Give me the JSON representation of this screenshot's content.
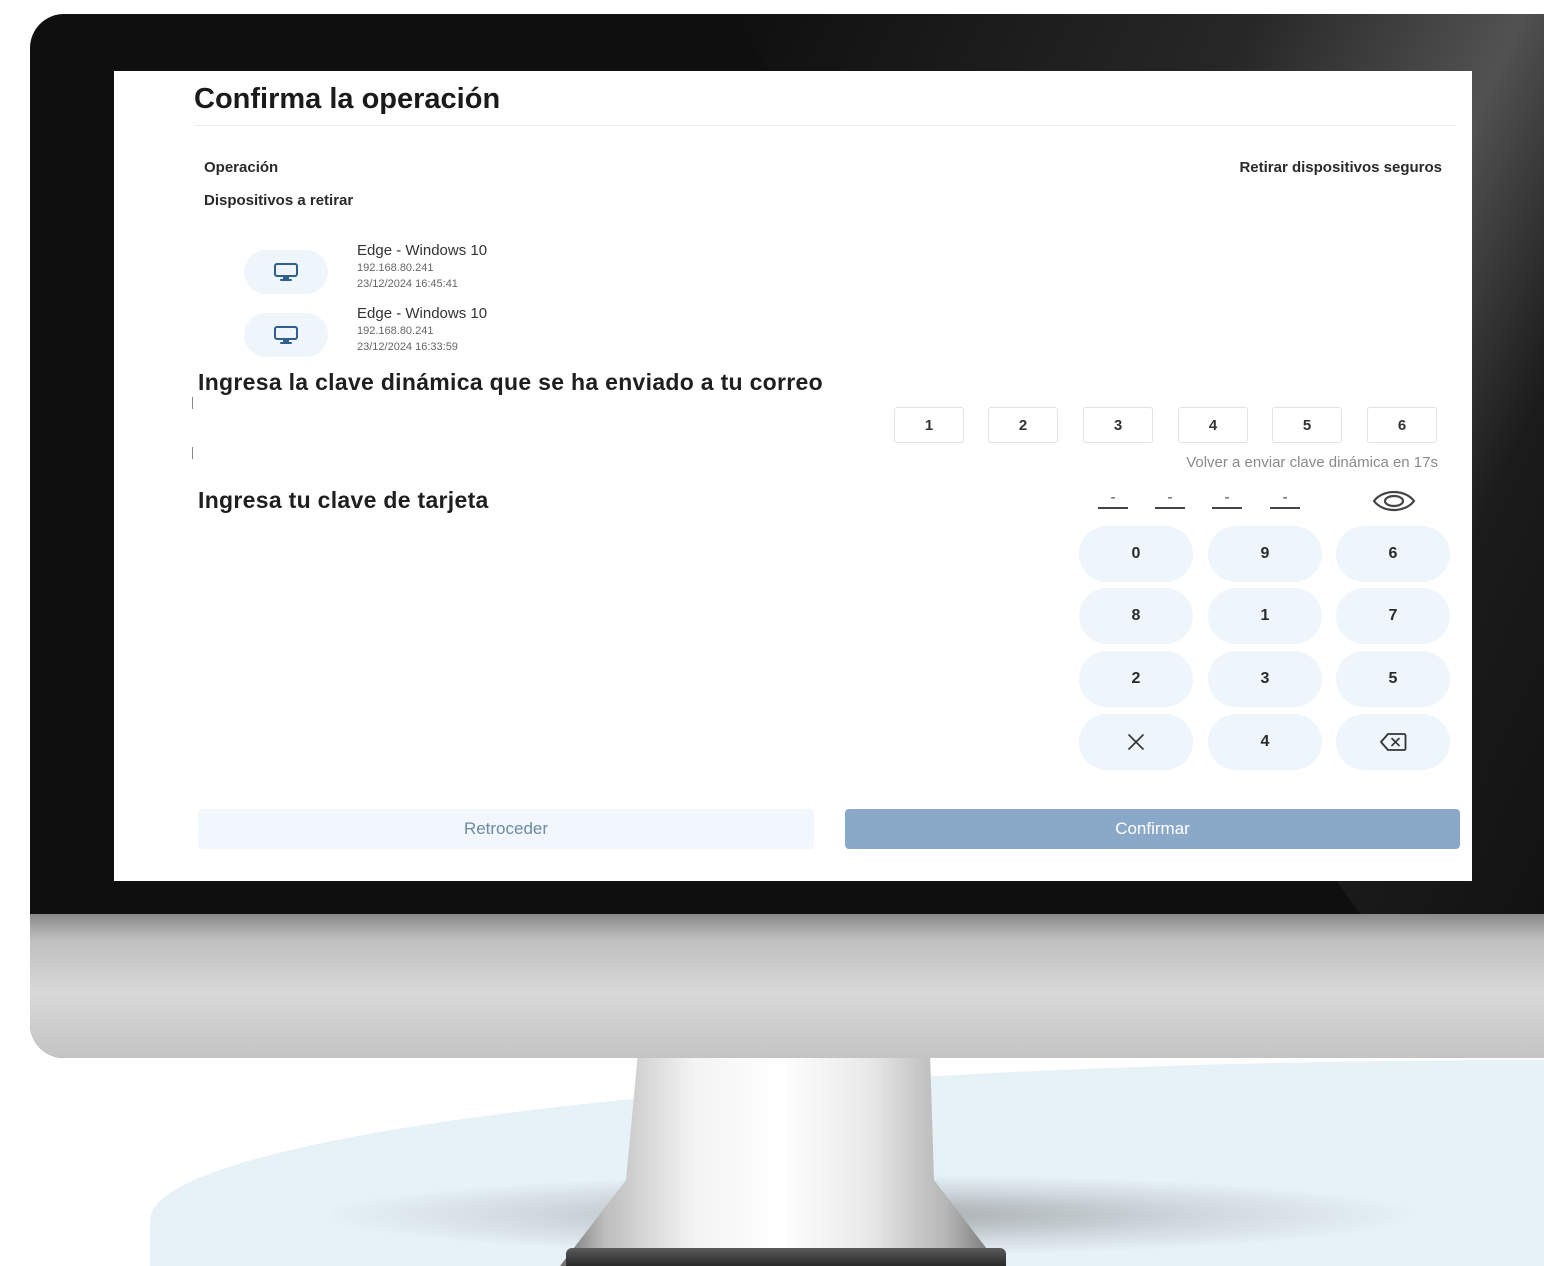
{
  "page": {
    "title": "Confirma la operación"
  },
  "operation": {
    "label": "Operación",
    "value": "Retirar dispositivos seguros"
  },
  "devices": {
    "label": "Dispositivos a retirar",
    "items": [
      {
        "name": "Edge - Windows 10",
        "ip": "192.168.80.241",
        "date": "23/12/2024 16:45:41",
        "icon": "monitor-icon"
      },
      {
        "name": "Edge - Windows 10",
        "ip": "192.168.80.241",
        "date": "23/12/2024 16:33:59",
        "icon": "monitor-icon"
      }
    ]
  },
  "dynamic_code": {
    "title": "Ingresa la clave dinámica que se ha enviado a tu correo",
    "digits": [
      "1",
      "2",
      "3",
      "4",
      "5",
      "6"
    ],
    "resend_text": "Volver a enviar clave dinámica en 17s"
  },
  "card_pin": {
    "title": "Ingresa tu clave de tarjeta",
    "placeholders": [
      "-",
      "-",
      "-",
      "-"
    ],
    "toggle_icon": "eye-icon",
    "keypad": {
      "rows": [
        [
          "0",
          "9",
          "6"
        ],
        [
          "8",
          "1",
          "7"
        ],
        [
          "2",
          "3",
          "5"
        ]
      ],
      "last_row_middle": "4",
      "clear_icon": "close-icon",
      "backspace_icon": "backspace-icon"
    }
  },
  "actions": {
    "back_label": "Retroceder",
    "confirm_label": "Confirmar"
  },
  "colors": {
    "accent": "#8aa9c8",
    "key_bg": "#eef5fb",
    "back_bg": "#f1f7fc"
  }
}
